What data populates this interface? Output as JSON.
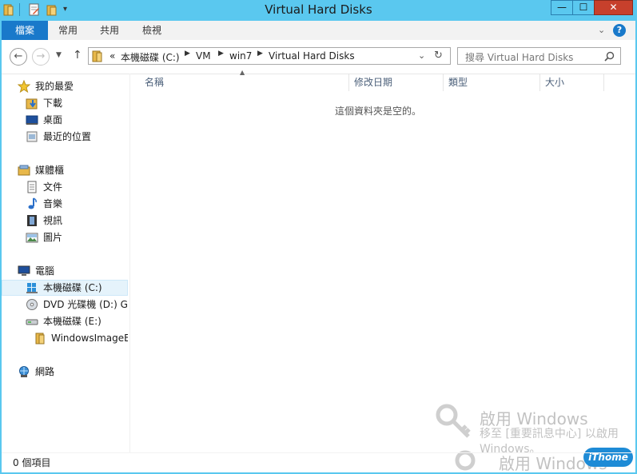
{
  "window": {
    "title": "Virtual Hard Disks",
    "controls": {
      "minimize": "—",
      "maximize": "☐",
      "close": "✕"
    }
  },
  "ribbon": {
    "tabs": [
      "檔案",
      "常用",
      "共用",
      "檢視"
    ],
    "expand_icon": "chevron-down-icon",
    "help_icon": "?"
  },
  "address": {
    "overflow": "«",
    "crumbs": [
      "本機磁碟 (C:)",
      "VM",
      "win7",
      "Virtual Hard Disks"
    ],
    "search_placeholder": "搜尋 Virtual Hard Disks"
  },
  "sidebar": {
    "favorites": {
      "label": "我的最愛",
      "items": [
        "下載",
        "桌面",
        "最近的位置"
      ]
    },
    "libraries": {
      "label": "媒體櫃",
      "items": [
        "文件",
        "音樂",
        "視訊",
        "圖片"
      ]
    },
    "computer": {
      "label": "電腦",
      "items": [
        "本機磁碟 (C:)",
        "DVD 光碟機 (D:) GR",
        "本機磁碟 (E:)",
        "WindowsImageB"
      ]
    },
    "network": {
      "label": "網路"
    }
  },
  "content": {
    "columns": [
      "名稱",
      "修改日期",
      "類型",
      "大小"
    ],
    "empty_message": "這個資料夾是空的。"
  },
  "status": {
    "item_count": "0 個項目"
  },
  "watermark": {
    "line1": "啟用 Windows",
    "line2": "移至 [重要訊息中心] 以啟用",
    "line3": "Windows。",
    "line4": "啟用 Windows",
    "badge": "iThome"
  },
  "colors": {
    "frame": "#5ac8ef",
    "file_tab": "#1979ca",
    "close_button": "#c7402c",
    "selection": "#e5f3fb",
    "folder": "#e8b84a"
  }
}
